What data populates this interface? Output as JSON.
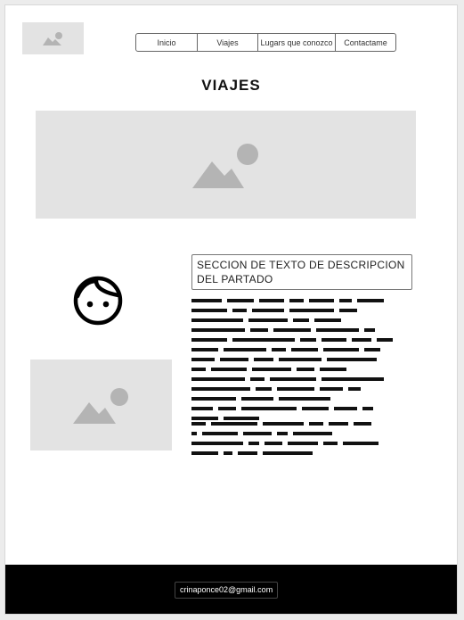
{
  "nav": {
    "items": [
      {
        "label": "Inicio"
      },
      {
        "label": "Viajes"
      },
      {
        "label": "Lugars que conozco"
      },
      {
        "label": "Contactame"
      }
    ]
  },
  "page_title": "VIAJES",
  "description": {
    "title": "SECCION DE TEXTO DE DESCRIPCION DEL PARTADO"
  },
  "footer": {
    "email": "crinaponce02@gmail.com"
  },
  "icons": {
    "logo": "image-placeholder-icon",
    "hero": "image-placeholder-icon",
    "side": "image-placeholder-icon",
    "avatar": "face-icon"
  },
  "colors": {
    "placeholder_bg": "#e3e3e3",
    "placeholder_icon": "#b4b4b4",
    "footer_bg": "#000000"
  }
}
